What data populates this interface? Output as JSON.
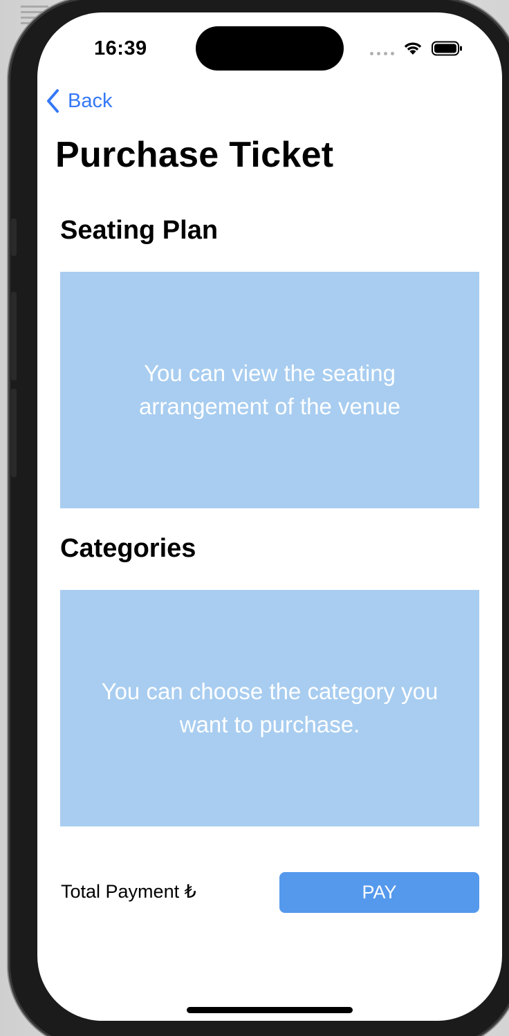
{
  "status_bar": {
    "time": "16:39",
    "wifi_icon": "wifi-icon",
    "battery_icon": "battery-icon"
  },
  "nav": {
    "back_label": "Back",
    "back_icon": "chevron-left-icon"
  },
  "page": {
    "title": "Purchase Ticket"
  },
  "seating": {
    "title": "Seating Plan",
    "placeholder": "You can view the seating arrangement of the venue"
  },
  "categories": {
    "title": "Categories",
    "placeholder": "You can choose the category you want to purchase."
  },
  "footer": {
    "total_label": "Total Payment ₺",
    "pay_label": "PAY"
  },
  "colors": {
    "accent": "#3478f6",
    "panel": "#a8cdf0",
    "pay_button": "#5599ec"
  }
}
